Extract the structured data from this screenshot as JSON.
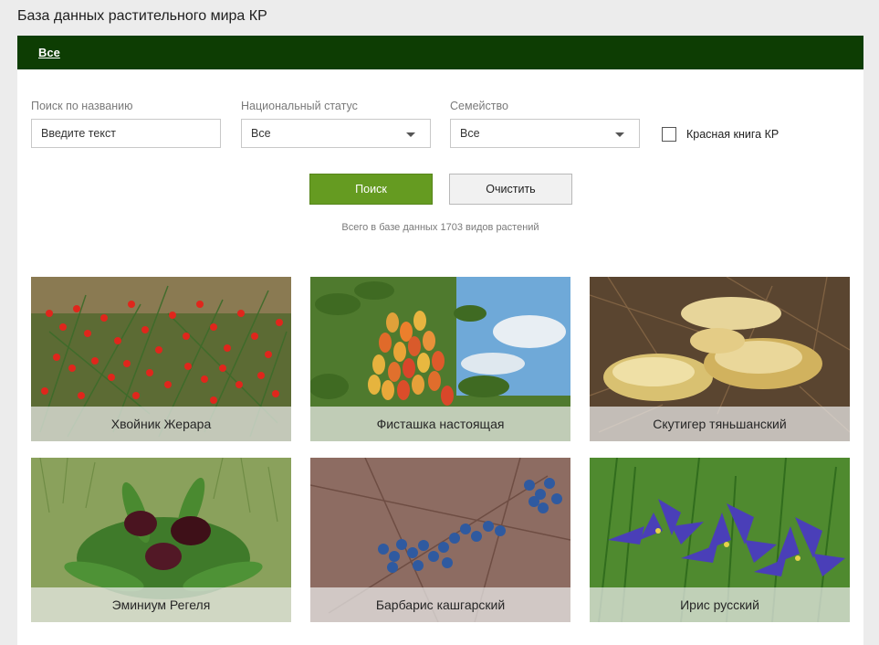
{
  "page": {
    "title": "База данных растительного мира КР"
  },
  "nav": {
    "all_label": "Все"
  },
  "filters": {
    "name_label": "Поиск по названию",
    "name_value": "Введите текст",
    "status_label": "Национальный статус",
    "status_value": "Все",
    "family_label": "Семейство",
    "family_value": "Все",
    "redbook_label": "Красная книга КР",
    "redbook_checked": false
  },
  "actions": {
    "search_label": "Поиск",
    "clear_label": "Очистить"
  },
  "summary": {
    "text": "Всего в базе данных 1703 видов растений"
  },
  "plants": [
    {
      "name": "Хвойник Жерара"
    },
    {
      "name": "Фисташка настоящая"
    },
    {
      "name": "Скутигер тяньшанский"
    },
    {
      "name": "Эминиум Регеля"
    },
    {
      "name": "Барбарис кашгарский"
    },
    {
      "name": "Ирис русский"
    }
  ]
}
